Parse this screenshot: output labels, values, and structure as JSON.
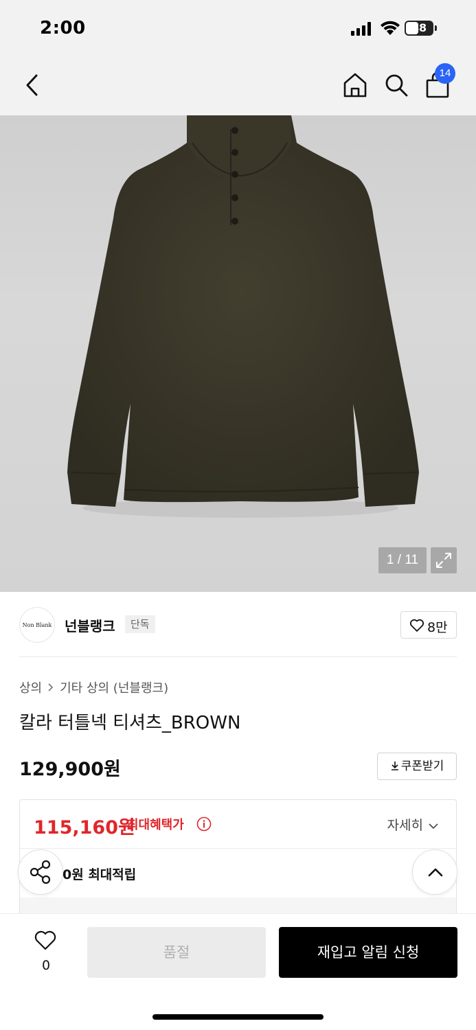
{
  "status_bar": {
    "time": "2:00",
    "battery": "48",
    "battery_level": 0.48
  },
  "nav": {
    "cart_count": "14"
  },
  "gallery": {
    "counter": "1 / 11"
  },
  "brand": {
    "logo_text": "Non Blank",
    "name": "넌블랭크",
    "badge": "단독",
    "likes": "8만"
  },
  "breadcrumb": {
    "items": [
      "상의",
      "기타 상의 (넌블랭크)"
    ]
  },
  "product": {
    "title": "칼라 터틀넥 티셔츠_BROWN",
    "price": "129,900원",
    "coupon_label": "쿠폰받기"
  },
  "benefit": {
    "max_price": "115,160원",
    "max_label": "최대혜택가",
    "details_label": "자세히",
    "points_text": "0원 최대적립"
  },
  "bottom_bar": {
    "wish_count": "0",
    "soldout_label": "품절",
    "restock_label": "재입고 알림 신청"
  },
  "colors": {
    "accent_red": "#e0262b",
    "badge_blue": "#2a63f6",
    "product_brown": "#3d3a2b"
  }
}
